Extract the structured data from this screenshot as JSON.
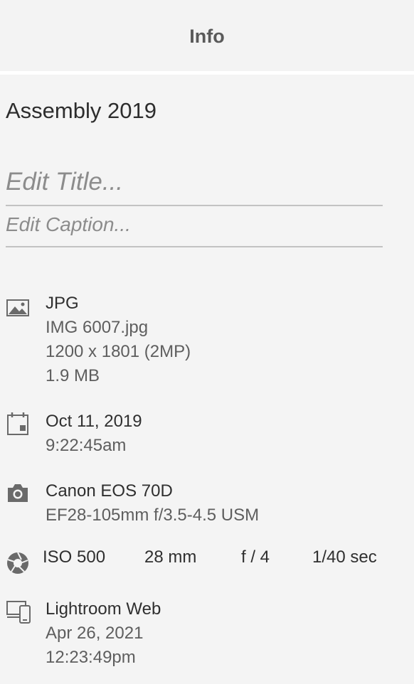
{
  "header": {
    "title": "Info"
  },
  "album": {
    "name": "Assembly 2019"
  },
  "edit": {
    "title_placeholder": "Edit Title...",
    "caption_placeholder": "Edit Caption..."
  },
  "file": {
    "format": "JPG",
    "filename": "IMG 6007.jpg",
    "dimensions": "1200 x 1801 (2MP)",
    "size": "1.9 MB",
    "icon": "image-icon"
  },
  "capture": {
    "date": "Oct 11, 2019",
    "time": "9:22:45am",
    "icon": "calendar-icon"
  },
  "camera": {
    "model": "Canon EOS 70D",
    "lens": "EF28-105mm f/3.5-4.5 USM",
    "icon": "camera-icon"
  },
  "exif": {
    "iso": "ISO 500",
    "focal_length": "28 mm",
    "aperture": "f / 4",
    "shutter": "1/40 sec",
    "icon": "aperture-icon"
  },
  "app": {
    "name": "Lightroom Web",
    "date": "Apr 26, 2021",
    "time": "12:23:49pm",
    "icon": "devices-icon"
  }
}
